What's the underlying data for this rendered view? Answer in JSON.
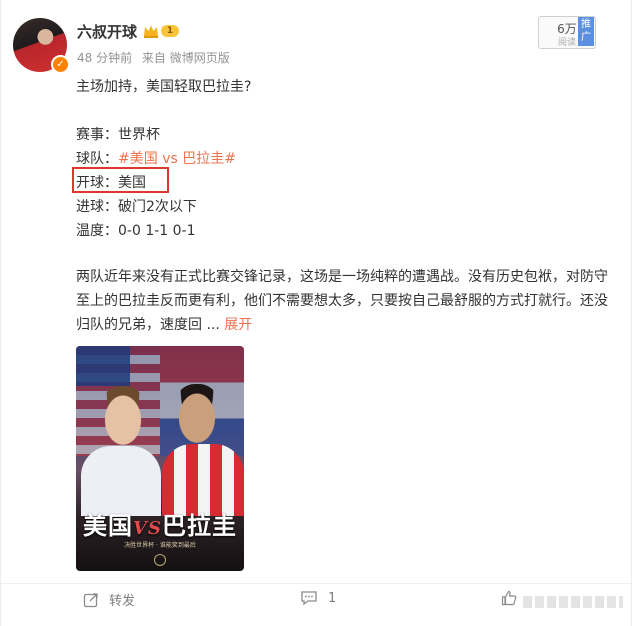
{
  "post": {
    "username": "六叔开球",
    "vip_level": "1",
    "time": "48 分钟前",
    "source": "来自 微博网页版",
    "views": "6万",
    "views_label": "阅读",
    "promo_label": "推广",
    "headline": "主场加持，美国轻取巴拉圭?",
    "lines": [
      {
        "label": "赛事：",
        "value": "世界杯"
      },
      {
        "label": "球队：",
        "tag1": "#美国",
        "vs": "vs",
        "tag2": "巴拉圭#"
      },
      {
        "label": "开球：",
        "value": "美国"
      },
      {
        "label": "进球：",
        "value": "破门2次以下"
      },
      {
        "label": "温度：",
        "value": "0-0 1-1 0-1"
      }
    ],
    "paragraph": "两队近年来没有正式比赛交锋记录，这场是一场纯粹的遭遇战。没有历史包袱，对防守至上的巴拉圭反而更有利，他们不需要想太多，只要按自己最舒服的方式打就行。还没归队的兄弟，速度回 ...",
    "expand_label": "展开",
    "poster": {
      "title_left": "美国",
      "title_vs": "VS",
      "title_right": "巴拉圭",
      "subtitle": "决胜世界杯 · 谁能笑到最后"
    }
  },
  "actions": {
    "repost_label": "转发",
    "comment_count": "1",
    "like_icon": "thumbs-up-icon",
    "repost_icon": "share-icon",
    "comment_icon": "comment-icon"
  },
  "colors": {
    "accent": "#eb7350",
    "highlight_border": "#d93a2b",
    "verified": "#ff8200"
  }
}
